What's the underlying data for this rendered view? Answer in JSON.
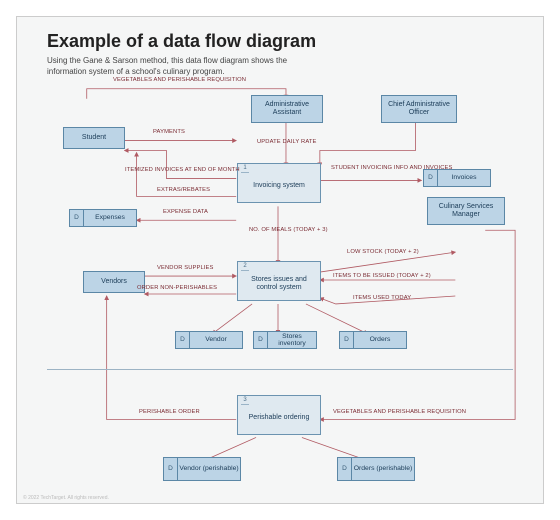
{
  "title": "Example of a data flow diagram",
  "subtitle": "Using the Gane & Sarson method, this data flow diagram shows the information system of a school's culinary program.",
  "entities": {
    "admin_assistant": "Administrative Assistant",
    "chief_officer": "Chief Administrative Officer",
    "student": "Student",
    "culinary_manager": "Culinary Services Manager",
    "vendors": "Vendors"
  },
  "processes": {
    "p1": {
      "num": "1",
      "label": "Invoicing system"
    },
    "p2": {
      "num": "2",
      "label": "Stores issues and control system"
    },
    "p3": {
      "num": "3",
      "label": "Perishable ordering"
    }
  },
  "datastores": {
    "invoices": {
      "d": "D",
      "label": "Invoices"
    },
    "expenses": {
      "d": "D",
      "label": "Expenses"
    },
    "vendor": {
      "d": "D",
      "label": "Vendor"
    },
    "stores_inv": {
      "d": "D",
      "label": "Stores inventory"
    },
    "orders": {
      "d": "D",
      "label": "Orders"
    },
    "vendor_perish": {
      "d": "D",
      "label": "Vendor (perishable)"
    },
    "orders_perish": {
      "d": "D",
      "label": "Orders (perishable)"
    }
  },
  "flows": {
    "veg_perish_req": "Vegetables and perishable requisition",
    "payments": "Payments",
    "update_daily_rate": "Update daily rate",
    "itemized_invoices": "Itemized invoices at end of month",
    "extras_rebates": "Extras/rebates",
    "student_invoicing": "Student invoicing info and invoices",
    "expense_data": "Expense data",
    "no_of_meals": "No. of meals (today + 3)",
    "low_stock": "Low stock (today + 2)",
    "items_to_issue": "Items to be issued (today + 2)",
    "items_used_today": "Items used today",
    "vendor_supplies": "Vendor supplies",
    "order_nonperish": "Order non-perishables",
    "perishable_order": "Perishable order",
    "veg_perish_req2": "Vegetables and perishable requisition"
  },
  "footer": "© 2022 TechTarget. All rights reserved."
}
